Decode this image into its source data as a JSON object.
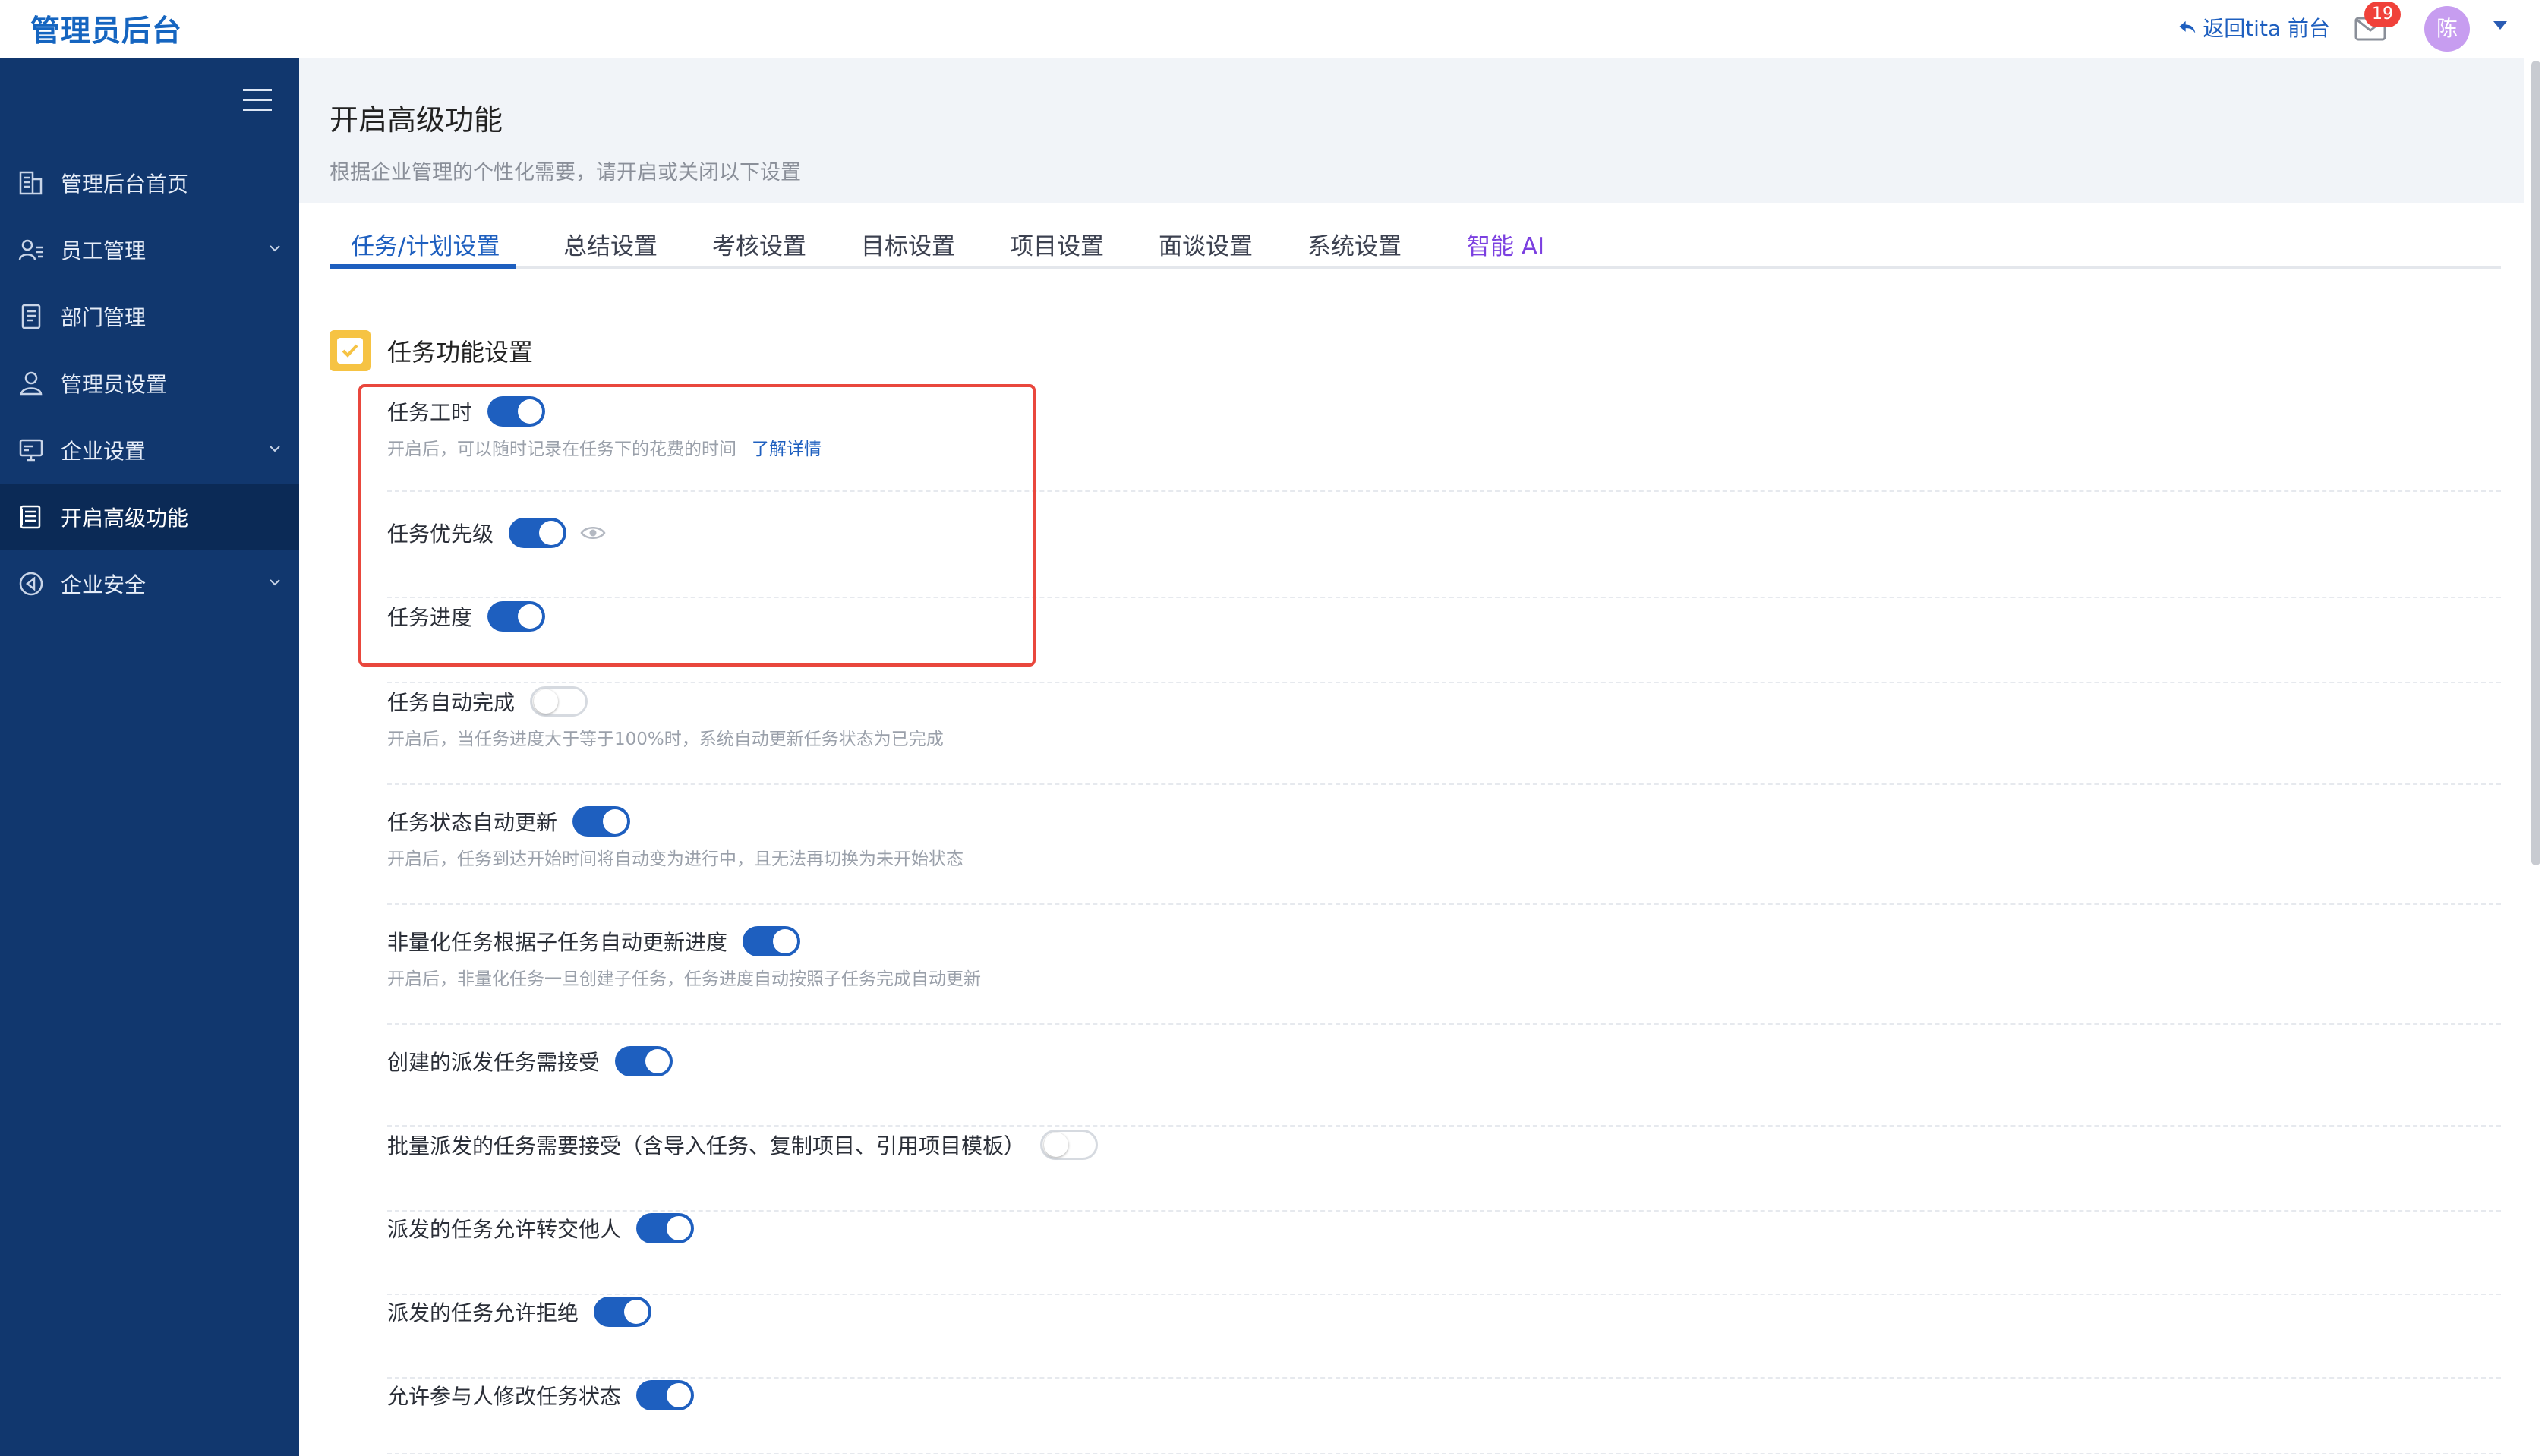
{
  "header": {
    "brand": "管理员后台",
    "back_link": "返回tita 前台",
    "mail_badge": "19",
    "avatar_text": "陈"
  },
  "sidebar": {
    "items": [
      {
        "label": "管理后台首页",
        "icon": "dashboard-icon",
        "has_submenu": false,
        "active": false
      },
      {
        "label": "员工管理",
        "icon": "user-list-icon",
        "has_submenu": true,
        "active": false
      },
      {
        "label": "部门管理",
        "icon": "document-icon",
        "has_submenu": false,
        "active": false
      },
      {
        "label": "管理员设置",
        "icon": "admin-user-icon",
        "has_submenu": false,
        "active": false
      },
      {
        "label": "企业设置",
        "icon": "monitor-icon",
        "has_submenu": true,
        "active": false
      },
      {
        "label": "开启高级功能",
        "icon": "feature-list-icon",
        "has_submenu": false,
        "active": true
      },
      {
        "label": "企业安全",
        "icon": "security-icon",
        "has_submenu": true,
        "active": false
      }
    ]
  },
  "page": {
    "title": "开启高级功能",
    "subtitle": "根据企业管理的个性化需要，请开启或关闭以下设置"
  },
  "tabs": [
    {
      "label": "任务/计划设置",
      "active": true
    },
    {
      "label": "总结设置",
      "active": false
    },
    {
      "label": "考核设置",
      "active": false
    },
    {
      "label": "目标设置",
      "active": false
    },
    {
      "label": "项目设置",
      "active": false
    },
    {
      "label": "面谈设置",
      "active": false
    },
    {
      "label": "系统设置",
      "active": false
    },
    {
      "label": "智能 AI",
      "active": false
    }
  ],
  "section": {
    "title": "任务功能设置"
  },
  "settings": [
    {
      "label": "任务工时",
      "enabled": true,
      "description": "开启后，可以随时记录在任务下的花费的时间",
      "link": "了解详情"
    },
    {
      "label": "任务优先级",
      "enabled": true,
      "eye_icon": true
    },
    {
      "label": "任务进度",
      "enabled": true
    },
    {
      "label": "任务自动完成",
      "enabled": false,
      "description": "开启后，当任务进度大于等于100%时，系统自动更新任务状态为已完成"
    },
    {
      "label": "任务状态自动更新",
      "enabled": true,
      "description": "开启后，任务到达开始时间将自动变为进行中，且无法再切换为未开始状态"
    },
    {
      "label": "非量化任务根据子任务自动更新进度",
      "enabled": true,
      "description": "开启后，非量化任务一旦创建子任务，任务进度自动按照子任务完成自动更新"
    },
    {
      "label": "创建的派发任务需接受",
      "enabled": true
    },
    {
      "label": "批量派发的任务需要接受（含导入任务、复制项目、引用项目模板）",
      "enabled": false
    },
    {
      "label": "派发的任务允许转交他人",
      "enabled": true
    },
    {
      "label": "派发的任务允许拒绝",
      "enabled": true
    },
    {
      "label": "允许参与人修改任务状态",
      "enabled": true
    }
  ],
  "colors": {
    "sidebar_bg": "#11376e",
    "accent": "#1e5fbf",
    "highlight_border": "#e9473d",
    "ai_tab": "#7b3fe0",
    "badge": "#f0413a"
  }
}
